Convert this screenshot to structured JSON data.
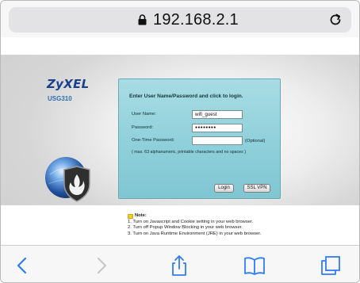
{
  "browser": {
    "url": "192.168.2.1",
    "icons": [
      "lock-icon",
      "reload-icon",
      "back-icon",
      "forward-icon",
      "share-icon",
      "bookmarks-icon",
      "tabs-icon"
    ],
    "accent": "#2f7cf6"
  },
  "page": {
    "brand": "ZyXEL",
    "model": "USG310",
    "login": {
      "title": "Enter User Name/Password and click to login.",
      "username_label": "User Name:",
      "username_value": "wifi_guest",
      "password_label": "Password:",
      "password_value": "●●●●●●●●",
      "otp_label": "One-Time Password:",
      "otp_value": "",
      "optional_label": "(Optional)",
      "hint": "( max. 63 alphanumeric, printable characters and no spaces )",
      "login_button": "Login",
      "sslvpn_button": "SSL VPN"
    },
    "note": {
      "title": "Note:",
      "items": [
        "1. Turn on Javascript and Cookie setting in your web browser.",
        "2. Turn off Popup Window Blocking in your web browser.",
        "3. Turn on Java Runtime Environment (JRE) in your web browser."
      ]
    }
  }
}
